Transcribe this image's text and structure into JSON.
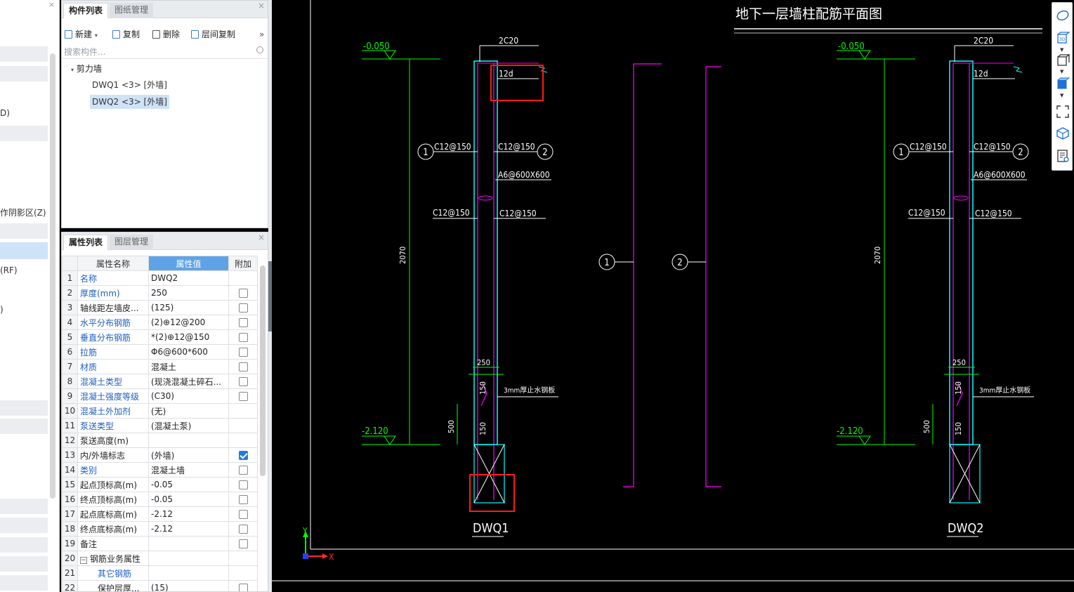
{
  "left_panel": {
    "fragments": [
      "D)",
      "作阴影区(Z)",
      "(RF)",
      ")"
    ]
  },
  "component_list": {
    "tabs": [
      "构件列表",
      "图纸管理"
    ],
    "close": "×",
    "toolbar": {
      "new": "新建",
      "copy": "复制",
      "delete": "删除",
      "floor_copy": "层间复制",
      "more": "»"
    },
    "search_placeholder": "搜索构件...",
    "tree_root": "剪力墙",
    "items": [
      "DWQ1 <3> [外墙]",
      "DWQ2 <3> [外墙]"
    ]
  },
  "property_list": {
    "tabs": [
      "属性列表",
      "图层管理"
    ],
    "close": "×",
    "headers": [
      "属性名称",
      "属性值",
      "附加"
    ],
    "rows": [
      {
        "idx": "1",
        "name": "名称",
        "value": "DWQ2",
        "blue": true,
        "check": "none"
      },
      {
        "idx": "2",
        "name": "厚度(mm)",
        "value": "250",
        "blue": true,
        "check": "off"
      },
      {
        "idx": "3",
        "name": "轴线距左墙皮...",
        "value": "(125)",
        "blue": false,
        "check": "off"
      },
      {
        "idx": "4",
        "name": "水平分布钢筋",
        "value": "(2)⊕12@200",
        "blue": true,
        "check": "off"
      },
      {
        "idx": "5",
        "name": "垂直分布钢筋",
        "value": "*(2)⊕12@150",
        "blue": true,
        "check": "off"
      },
      {
        "idx": "6",
        "name": "拉筋",
        "value": "Φ6@600*600",
        "blue": true,
        "check": "off"
      },
      {
        "idx": "7",
        "name": "材质",
        "value": "混凝土",
        "blue": true,
        "check": "off"
      },
      {
        "idx": "8",
        "name": "混凝土类型",
        "value": "(现浇混凝土碎石...",
        "blue": true,
        "check": "off"
      },
      {
        "idx": "9",
        "name": "混凝土强度等级",
        "value": "(C30)",
        "blue": true,
        "check": "off"
      },
      {
        "idx": "10",
        "name": "混凝土外加剂",
        "value": "(无)",
        "blue": true,
        "check": "none"
      },
      {
        "idx": "11",
        "name": "泵送类型",
        "value": "(混凝土泵)",
        "blue": true,
        "check": "none"
      },
      {
        "idx": "12",
        "name": "泵送高度(m)",
        "value": "",
        "blue": false,
        "check": "none"
      },
      {
        "idx": "13",
        "name": "内/外墙标志",
        "value": "(外墙)",
        "blue": false,
        "check": "on"
      },
      {
        "idx": "14",
        "name": "类别",
        "value": "混凝土墙",
        "blue": true,
        "check": "off"
      },
      {
        "idx": "15",
        "name": "起点顶标高(m)",
        "value": "-0.05",
        "blue": false,
        "check": "off"
      },
      {
        "idx": "16",
        "name": "终点顶标高(m)",
        "value": "-0.05",
        "blue": false,
        "check": "off"
      },
      {
        "idx": "17",
        "name": "起点底标高(m)",
        "value": "-2.12",
        "blue": false,
        "check": "off"
      },
      {
        "idx": "18",
        "name": "终点底标高(m)",
        "value": "-2.12",
        "blue": false,
        "check": "off"
      },
      {
        "idx": "19",
        "name": "备注",
        "value": "",
        "blue": false,
        "check": "off"
      },
      {
        "idx": "20",
        "name": "钢筋业务属性",
        "value": "",
        "blue": false,
        "check": "none",
        "group": true
      },
      {
        "idx": "21",
        "name": "其它钢筋",
        "value": "",
        "blue": true,
        "check": "none",
        "indent": true
      },
      {
        "idx": "22",
        "name": "保护层厚...",
        "value": "(15)",
        "blue": false,
        "check": "off",
        "indent": true
      }
    ]
  },
  "drawing": {
    "title": "地下一层墙柱配筋平面图",
    "elev_top": "-0.050",
    "elev_bottom": "-2.120",
    "height_dim": "2070",
    "top_bar": "2C20",
    "anchor": "12d",
    "rebar_left": "C12@150",
    "rebar_right": "C12@150",
    "tie": "A6@600X600",
    "width_dim": "250",
    "dim_150": "150",
    "dim_500": "500",
    "membrane": "3mm厚止水钢板",
    "wall_labels": [
      "DWQ1",
      "DWQ2"
    ],
    "section_marks": [
      "1",
      "2"
    ],
    "axis_x": "X",
    "axis_y": "Y"
  },
  "colors": {
    "cad_green": "#00ff00",
    "cad_cyan": "#00ffff",
    "cad_magenta": "#ff00ff",
    "highlight_red": "#ff1a1a",
    "selection_blue": "#cfe3f7"
  },
  "view_toolbar": {
    "icons": [
      "orbit-icon",
      "3d-view-icon",
      "box-view-icon",
      "box-solid-icon",
      "fit-view-icon",
      "cube-check-icon",
      "settings-list-icon"
    ]
  }
}
